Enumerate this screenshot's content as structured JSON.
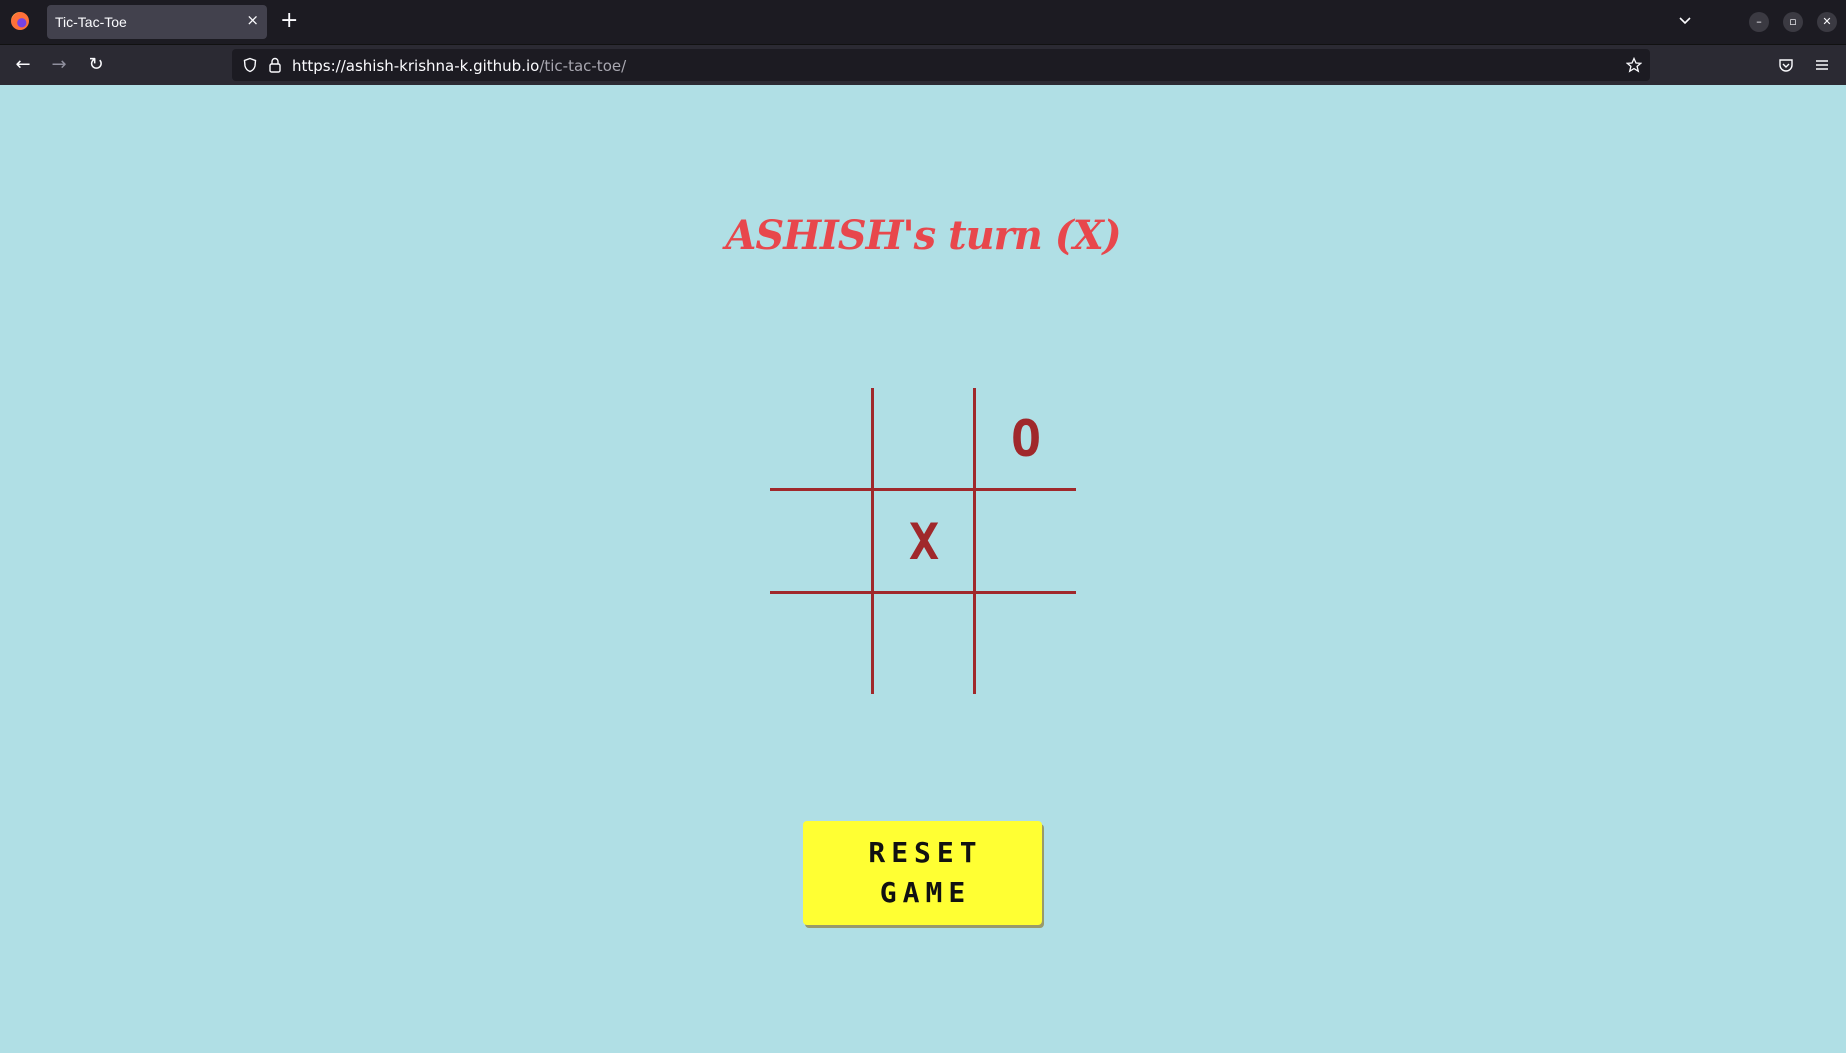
{
  "browser": {
    "tab_title": "Tic-Tac-Toe",
    "tab_close": "×",
    "new_tab": "+",
    "url_host": "https://ashish-krishna-k.github.io",
    "url_path": "/tic-tac-toe/"
  },
  "game": {
    "status": "ASHISH's turn (X)",
    "board": [
      "",
      "",
      "O",
      "",
      "X",
      "",
      "",
      "",
      ""
    ],
    "reset_label": "RESET\nGAME"
  },
  "colors": {
    "background": "#b0dfe5",
    "status_text": "#e8474c",
    "grid_and_marks": "#a0282b",
    "reset_button": "#ffff33"
  }
}
